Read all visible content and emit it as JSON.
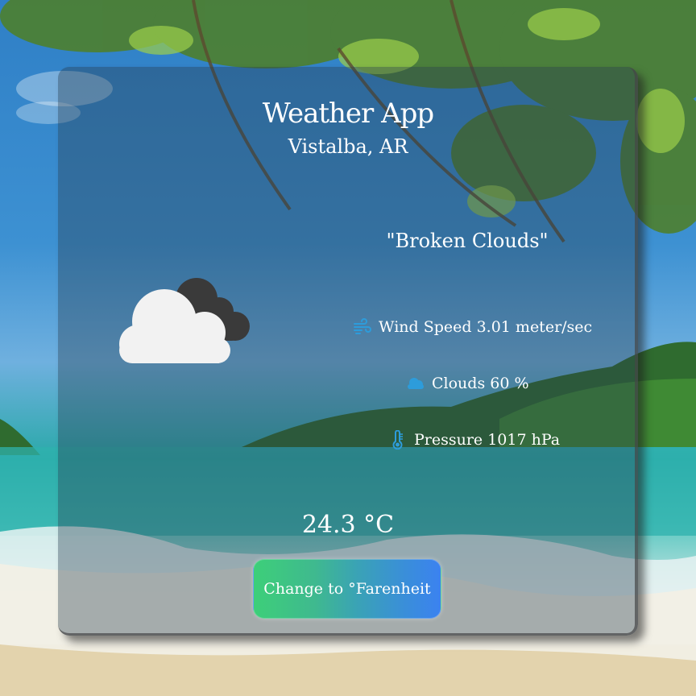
{
  "app": {
    "title": "Weather App",
    "location": "Vistalba, AR"
  },
  "weather": {
    "description": "\"Broken Clouds\"",
    "icon": "broken-clouds-icon",
    "temperature": "24.3 °C"
  },
  "stats": {
    "wind": {
      "label": "Wind Speed 3.01 meter/sec",
      "icon": "wind-icon"
    },
    "clouds": {
      "label": "Clouds 60 %",
      "icon": "cloud-icon"
    },
    "pressure": {
      "label": "Pressure 1017 hPa",
      "icon": "thermometer-icon"
    }
  },
  "controls": {
    "unit_toggle_label": "Change to °Farenheit"
  },
  "colors": {
    "icon_accent": "#2d9cdb",
    "button_gradient_start": "#3dcf79",
    "button_gradient_end": "#3b82f0"
  }
}
